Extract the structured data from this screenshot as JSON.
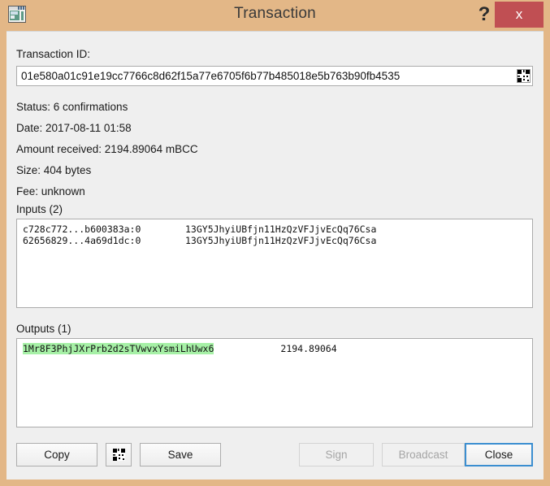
{
  "window": {
    "title": "Transaction",
    "icon": "transaction-window-icon",
    "help_label": "?",
    "close_label": "x",
    "titlebar_color": "#e3b787",
    "close_button_color": "#c04f53"
  },
  "transaction": {
    "txid_label": "Transaction ID:",
    "txid_value": "01e580a01c91e19cc7766c8d62f15a77e6705f6b77b485018e5b763b90fb4535",
    "txid_qr_icon": "qr-code-icon",
    "info_lines": [
      "Status: 6 confirmations",
      "Date: 2017-08-11 01:58",
      "Amount received: 2194.89064 mBCC",
      "Size: 404 bytes",
      "Fee: unknown"
    ],
    "status": "6 confirmations",
    "date": "2017-08-11 01:58",
    "amount_received": "2194.89064 mBCC",
    "size": "404 bytes",
    "fee": "unknown"
  },
  "inputs": {
    "label": "Inputs (2)",
    "count": 2,
    "rows": [
      {
        "outpoint": "c728c772...b600383a:0",
        "address": "13GY5JhyiUBfjn11HzQzVFJjvEcQq76Csa"
      },
      {
        "outpoint": "62656829...4a69d1dc:0",
        "address": "13GY5JhyiUBfjn11HzQzVFJjvEcQq76Csa"
      }
    ]
  },
  "outputs": {
    "label": "Outputs (1)",
    "count": 1,
    "highlight_color": "#a6f0a6",
    "rows": [
      {
        "address": "1Mr8F3PhjJXrPrb2d2sTVwvxYsmiLhUwx6",
        "amount": "2194.89064"
      }
    ]
  },
  "buttons": {
    "copy": "Copy",
    "qr_icon": "qr-code-icon",
    "save": "Save",
    "sign": "Sign",
    "broadcast": "Broadcast",
    "close": "Close"
  }
}
